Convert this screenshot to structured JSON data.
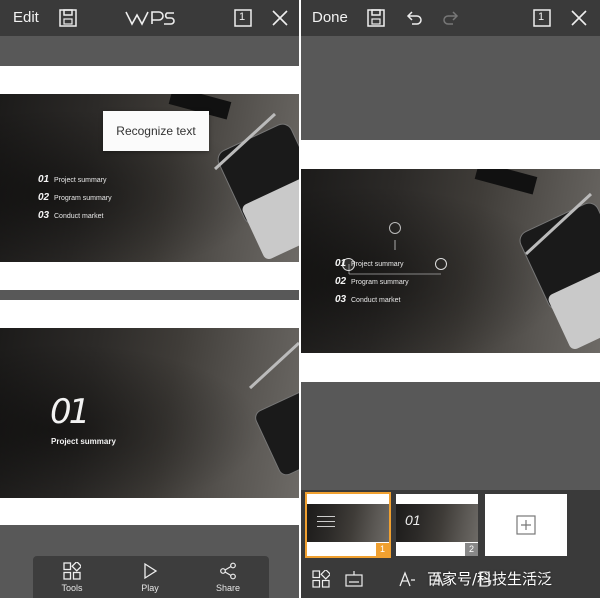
{
  "left_panel": {
    "topbar": {
      "edit_label": "Edit",
      "logo_text": "WPS",
      "page_count": "1"
    },
    "popup": {
      "label": "Recognize text"
    },
    "slide1": {
      "agenda": [
        {
          "num": "01",
          "label": "Project summary"
        },
        {
          "num": "02",
          "label": "Program summary"
        },
        {
          "num": "03",
          "label": "Conduct market"
        }
      ]
    },
    "slide2": {
      "big_number": "01",
      "title": "Project summary"
    },
    "toolbar": {
      "tools_label": "Tools",
      "play_label": "Play",
      "share_label": "Share"
    }
  },
  "right_panel": {
    "topbar": {
      "done_label": "Done",
      "page_count": "1"
    },
    "slide": {
      "agenda": [
        {
          "num": "01",
          "label": "Project summary"
        },
        {
          "num": "02",
          "label": "Program summary"
        },
        {
          "num": "03",
          "label": "Conduct market"
        }
      ]
    },
    "thumbnails": [
      {
        "number": "1",
        "selected": true
      },
      {
        "number": "2",
        "selected": false
      }
    ],
    "add_slide_icon": "plus-icon"
  },
  "watermark": "百家号/科技生活泛",
  "colors": {
    "accent": "#f0a030",
    "topbar": "#3a3a3a",
    "panel": "#585858"
  }
}
